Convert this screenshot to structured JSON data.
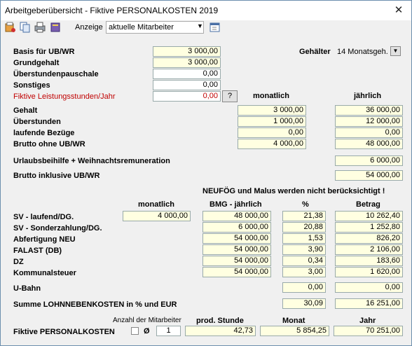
{
  "window": {
    "title": "Arbeitgeberübersicht - Fiktive PERSONALKOSTEN 2019",
    "close": "✕"
  },
  "toolbar": {
    "anzeige_label": "Anzeige",
    "anzeige_value": "aktuelle Mitarbeiter"
  },
  "top": {
    "labels": {
      "basis": "Basis für UB/WR",
      "grundgehalt": "Grundgehalt",
      "ueberstundenpauschale": "Überstundenpauschale",
      "sonstiges": "Sonstiges",
      "fiktive": "Fiktive Leistungsstunden/Jahr"
    },
    "values": {
      "basis": "3 000,00",
      "grundgehalt": "3 000,00",
      "ueberstundenpauschale": "0,00",
      "sonstiges": "0,00",
      "fiktive": "0,00"
    },
    "help_label": "?",
    "gehaelter_label": "Gehälter",
    "gehaelter_value": "14 Monatsgeh."
  },
  "gehalt": {
    "col_monatlich": "monatlich",
    "col_jaehrlich": "jährlich",
    "rows": [
      {
        "label": "Gehalt",
        "monatlich": "3 000,00",
        "jaehrlich": "36 000,00"
      },
      {
        "label": "Überstunden",
        "monatlich": "1 000,00",
        "jaehrlich": "12 000,00"
      },
      {
        "label": "laufende Bezüge",
        "monatlich": "0,00",
        "jaehrlich": "0,00"
      },
      {
        "label": "Brutto ohne UB/WR",
        "monatlich": "4 000,00",
        "jaehrlich": "48 000,00"
      }
    ],
    "urlaub_label": "Urlaubsbeihilfe + Weihnachtsremuneration",
    "urlaub_value": "6 000,00",
    "brutto_inkl_label": "Brutto inklusive UB/WR",
    "brutto_inkl_value": "54 000,00"
  },
  "neufoeg_note": "NEUFÖG und Malus werden nicht berücksichtigt !",
  "nebenkosten": {
    "col_monatlich": "monatlich",
    "col_bmg": "BMG - jährlich",
    "col_pct": "%",
    "col_betrag": "Betrag",
    "rows": [
      {
        "label": "SV - laufend/DG.",
        "monatlich": "4 000,00",
        "bmg": "48 000,00",
        "pct": "21,38",
        "betrag": "10 262,40"
      },
      {
        "label": "SV - Sonderzahlung/DG.",
        "bmg": "6 000,00",
        "pct": "20,88",
        "betrag": "1 252,80"
      },
      {
        "label": "Abfertigung NEU",
        "bmg": "54 000,00",
        "pct": "1,53",
        "betrag": "826,20"
      },
      {
        "label": "FALAST (DB)",
        "bmg": "54 000,00",
        "pct": "3,90",
        "betrag": "2 106,00"
      },
      {
        "label": "DZ",
        "bmg": "54 000,00",
        "pct": "0,34",
        "betrag": "183,60"
      },
      {
        "label": "Kommunalsteuer",
        "bmg": "54 000,00",
        "pct": "3,00",
        "betrag": "1 620,00"
      }
    ],
    "ubahn_label": "U-Bahn",
    "ubahn_pct": "0,00",
    "ubahn_betrag": "0,00",
    "summe_label": "Summe LOHNNEBENKOSTEN in % und EUR",
    "summe_pct": "30,09",
    "summe_betrag": "16 251,00"
  },
  "footer": {
    "anzahl_label": "Anzahl der Mitarbeiter",
    "fiktive_label": "Fiktive PERSONALKOSTEN",
    "avg_symbol": "Ø",
    "anzahl_value": "1",
    "prod_label": "prod. Stunde",
    "prod_value": "42,73",
    "monat_label": "Monat",
    "monat_value": "5 854,25",
    "jahr_label": "Jahr",
    "jahr_value": "70 251,00"
  }
}
